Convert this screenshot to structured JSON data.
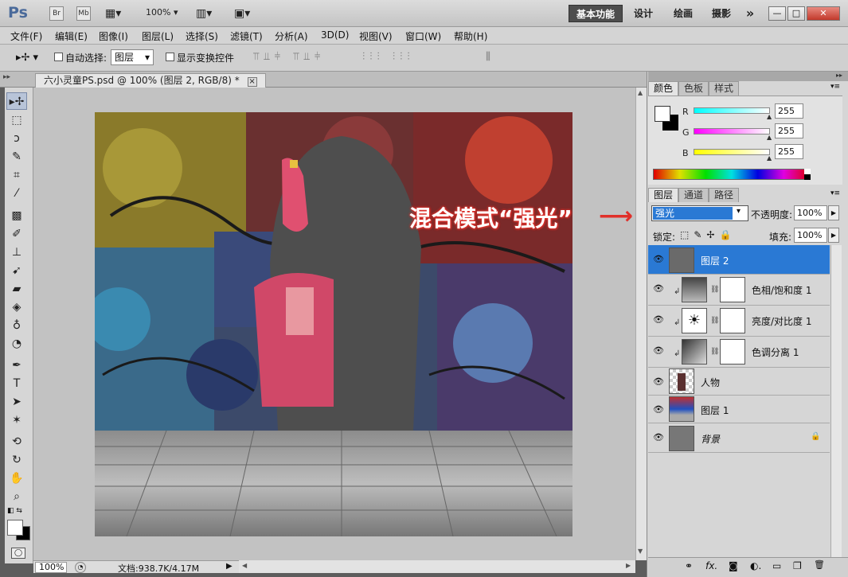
{
  "titlebar": {
    "logo": "Ps",
    "br": "Br",
    "mb": "Mb",
    "zoom": "100%",
    "workspaces": [
      "基本功能",
      "设计",
      "绘画",
      "摄影"
    ],
    "more": "»",
    "window_buttons": [
      "—",
      "□",
      "✕"
    ]
  },
  "menu": [
    "文件(F)",
    "编辑(E)",
    "图像(I)",
    "图层(L)",
    "选择(S)",
    "滤镜(T)",
    "分析(A)",
    "3D(D)",
    "视图(V)",
    "窗口(W)",
    "帮助(H)"
  ],
  "options": {
    "auto_select_label": "自动选择:",
    "auto_select_value": "图层",
    "show_transform_label": "显示变换控件"
  },
  "document": {
    "tab_title": "六小灵童PS.psd @ 100% (图层 2, RGB/8) *",
    "tab_close": "×"
  },
  "status": {
    "zoom": "100%",
    "doc_info": "文档:938.7K/4.17M"
  },
  "color_panel": {
    "tabs": [
      "颜色",
      "色板",
      "样式"
    ],
    "r_label": "R",
    "r_value": "255",
    "g_label": "G",
    "g_value": "255",
    "b_label": "B",
    "b_value": "255"
  },
  "layers_panel": {
    "tabs": [
      "图层",
      "通道",
      "路径"
    ],
    "blend_mode": "强光",
    "opacity_label": "不透明度:",
    "opacity_value": "100%",
    "lock_label": "锁定:",
    "fill_label": "填充:",
    "fill_value": "100%",
    "layers": [
      {
        "name": "图层 2",
        "selected": true,
        "type": "pixel"
      },
      {
        "name": "色相/饱和度 1",
        "selected": false,
        "type": "adjustment"
      },
      {
        "name": "亮度/对比度 1",
        "selected": false,
        "type": "adjustment"
      },
      {
        "name": "色调分离 1",
        "selected": false,
        "type": "adjustment"
      },
      {
        "name": "人物",
        "selected": false,
        "type": "pixel"
      },
      {
        "name": "图层 1",
        "selected": false,
        "type": "pixel"
      },
      {
        "name": "背景",
        "selected": false,
        "type": "background",
        "locked": true
      }
    ],
    "bottom_icons": [
      "link-icon",
      "fx-icon",
      "mask-icon",
      "adjustment-icon",
      "group-icon",
      "new-layer-icon",
      "trash-icon"
    ],
    "bottom_glyphs": [
      "⚭",
      "fx.",
      "◙",
      "◐.",
      "▭",
      "❐",
      "🗑"
    ]
  },
  "annotation": {
    "text": "混合模式“强光”",
    "arrow": "⟶"
  },
  "colors": {
    "selection_blue": "#2a79d4",
    "annotation_red": "#e0302a"
  }
}
